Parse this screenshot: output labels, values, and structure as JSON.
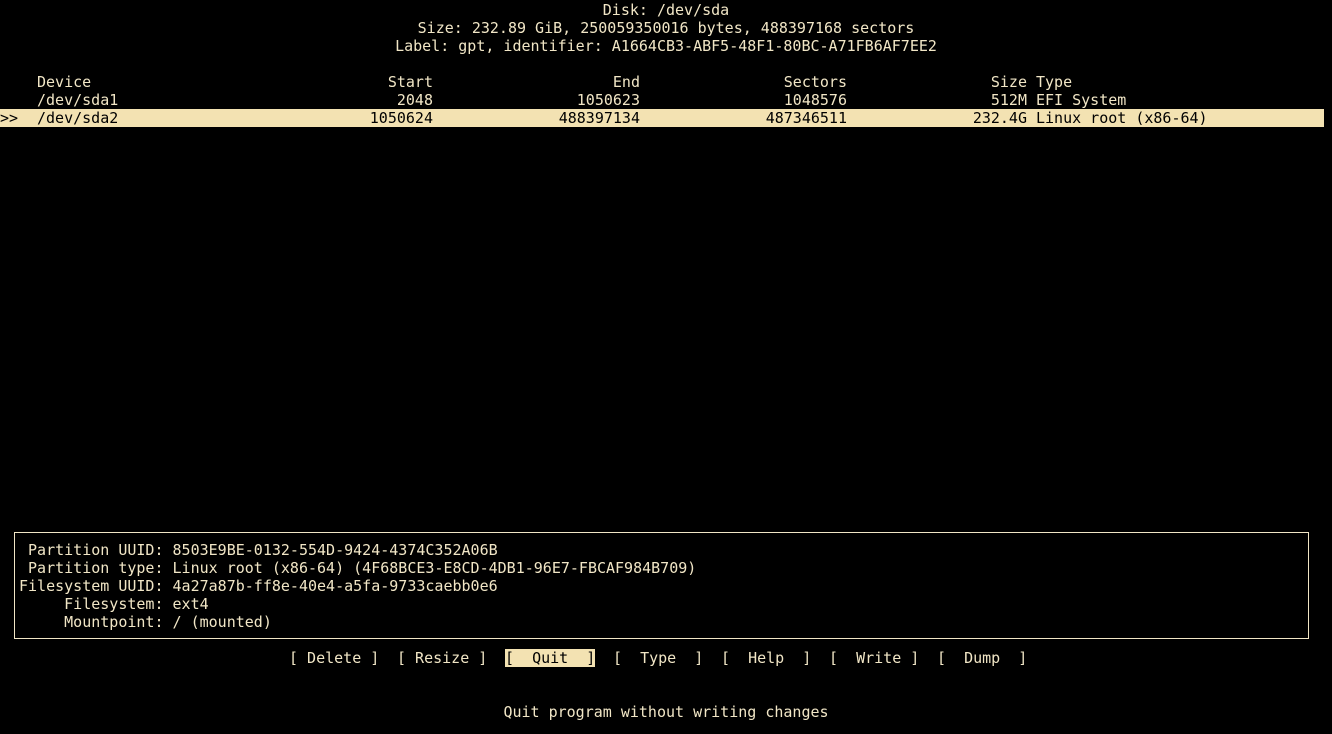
{
  "header": {
    "disk": "Disk: /dev/sda",
    "size": "Size: 232.89 GiB, 250059350016 bytes, 488397168 sectors",
    "label": "Label: gpt, identifier: A1664CB3-ABF5-48F1-80BC-A71FB6AF7EE2"
  },
  "table": {
    "columns": {
      "device": "Device",
      "start": "Start",
      "end": "End",
      "sectors": "Sectors",
      "size": "Size",
      "type": "Type"
    },
    "rows": [
      {
        "marker": "",
        "device": "/dev/sda1",
        "start": "2048",
        "end": "1050623",
        "sectors": "1048576",
        "size": "512M",
        "type": "EFI System"
      },
      {
        "marker": ">>",
        "device": "/dev/sda2",
        "start": "1050624",
        "end": "488397134",
        "sectors": "487346511",
        "size": "232.4G",
        "type": "Linux root (x86-64)"
      }
    ]
  },
  "info": {
    "lines": [
      " Partition UUID: 8503E9BE-0132-554D-9424-4374C352A06B",
      " Partition type: Linux root (x86-64) (4F68BCE3-E8CD-4DB1-96E7-FBCAF984B709)",
      "Filesystem UUID: 4a27a87b-ff8e-40e4-a5fa-9733caebb0e6",
      "     Filesystem: ext4",
      "     Mountpoint: / (mounted)"
    ]
  },
  "menu": {
    "delete": "[ Delete ]",
    "resize": "[ Resize ]",
    "quit": "[  Quit  ]",
    "type": "[  Type  ]",
    "help": "[  Help  ]",
    "write": "[  Write ]",
    "dump": "[  Dump  ]"
  },
  "status": "Quit program without writing changes",
  "colors": {
    "background": "#000000",
    "foreground": "#f1e6c6",
    "highlight": "#f3e2b2"
  }
}
